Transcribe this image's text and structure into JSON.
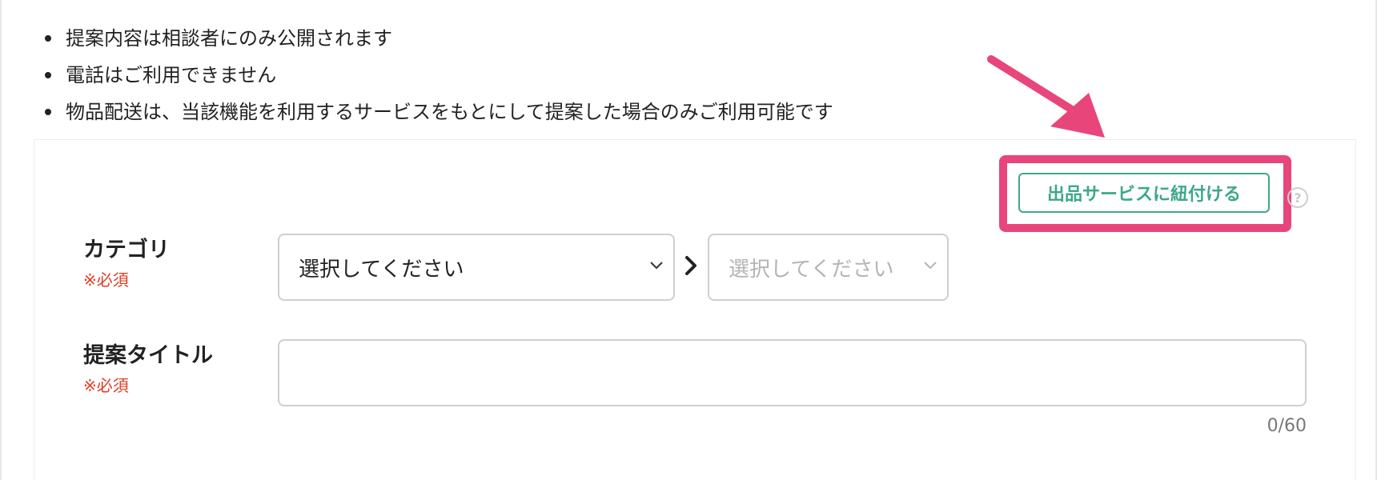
{
  "notes": [
    "提案内容は相談者にのみ公開されます",
    "電話はご利用できません",
    "物品配送は、当該機能を利用するサービスをもとにして提案した場合のみご利用可能です"
  ],
  "link_service_button": {
    "label": "出品サービスに紐付ける",
    "help_glyph": "?"
  },
  "category": {
    "label": "カテゴリ",
    "required": "※必須",
    "select_primary": "選択してください",
    "select_secondary": "選択してください"
  },
  "title_field": {
    "label": "提案タイトル",
    "required": "※必須",
    "value": "",
    "counter": "0/60"
  },
  "colors": {
    "accent_green": "#3ea78a",
    "highlight_pink": "#e8467b",
    "required_red": "#e03b24"
  },
  "icons": [
    "pointer-arrow-icon",
    "help-icon",
    "chevron-down-icon",
    "chevron-right-icon"
  ]
}
